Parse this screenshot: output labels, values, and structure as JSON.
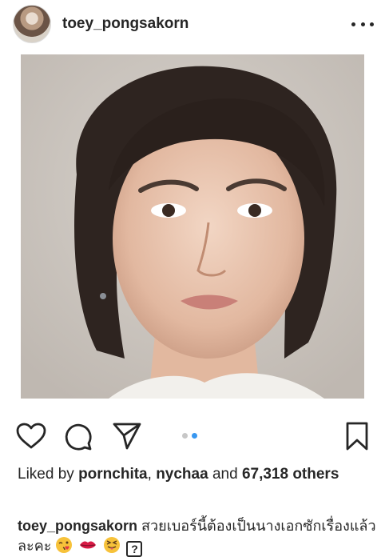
{
  "post": {
    "username": "toey_pongsakorn",
    "more_icon": "more-horizontal-icon"
  },
  "actions": {
    "icons": [
      "heart-icon",
      "comment-icon",
      "share-icon",
      "bookmark-icon"
    ],
    "carousel": {
      "count": 2,
      "active_index": 1
    }
  },
  "likes": {
    "prefix": "Liked by",
    "user1": "pornchita",
    "separator": ",",
    "user2": "nychaa",
    "and": "and",
    "count_text": "67,318 others"
  },
  "caption": {
    "username": "toey_pongsakorn",
    "text": "สวยเบอร์นี้ต้องเป็นนางเอกซักเรื่องแล้วละคะ",
    "emojis": [
      "kiss-wink-emoji",
      "lips-emoji",
      "squinting-tongue-emoji",
      "unknown-glyph"
    ],
    "unknown_glyph": "?"
  },
  "colors": {
    "text": "#262626",
    "dot_active": "#3897f0",
    "dot_inactive": "#c7c7c7"
  }
}
